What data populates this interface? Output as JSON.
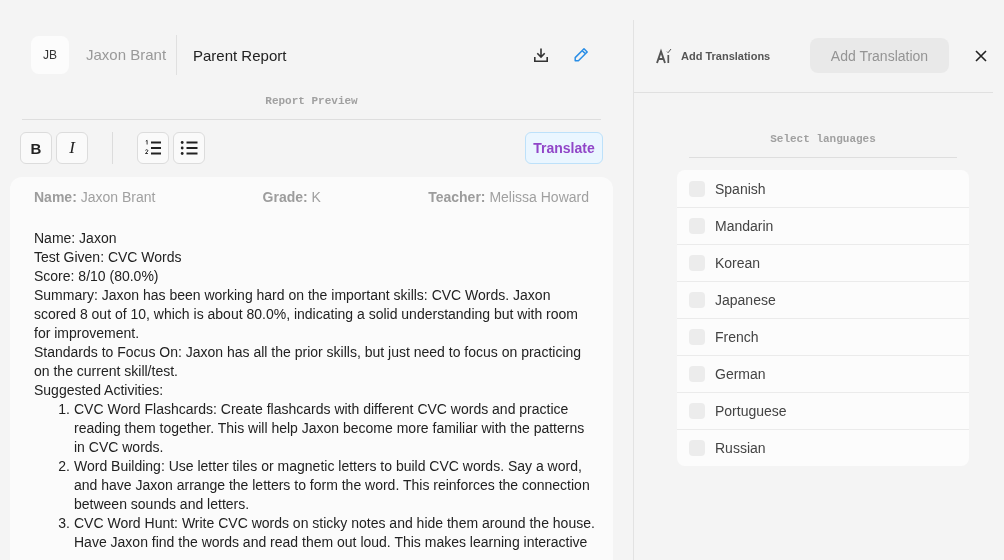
{
  "header": {
    "avatar": "JB",
    "student": "Jaxon Brant",
    "title": "Parent Report"
  },
  "preview_label": "Report Preview",
  "toolbar": {
    "groups": [
      {
        "items": [
          {
            "kind": "bold",
            "label": "B"
          },
          {
            "kind": "italic",
            "label": "I"
          }
        ]
      },
      {
        "items": [
          {
            "kind": "ordered-list"
          },
          {
            "kind": "bullet-list"
          }
        ]
      }
    ],
    "translate": "Translate"
  },
  "report": {
    "details": [
      {
        "label": "Name:",
        "value": "Jaxon Brant"
      },
      {
        "label": "Grade:",
        "value": "K"
      },
      {
        "label": "Teacher:",
        "value": "Melissa Howard"
      }
    ],
    "lines": [
      "Name: Jaxon",
      "Test Given: CVC Words",
      "Score: 8/10 (80.0%)",
      "Summary: Jaxon has been working hard on the important skills: CVC Words. Jaxon scored 8 out of 10, which is about 80.0%, indicating a solid understanding but with room for improvement.",
      "Standards to Focus On: Jaxon has all the prior skills, but just need to focus on practicing on the current skill/test.",
      "Suggested Activities:"
    ],
    "activities": [
      {
        "number": "1.",
        "text": "CVC Word Flashcards: Create flashcards with different CVC words and practice reading them together. This will help Jaxon become more familiar with the patterns in CVC words."
      },
      {
        "number": "2.",
        "text": "Word Building: Use letter tiles or magnetic letters to build CVC words. Say a word, and have Jaxon arrange the letters to form the word. This reinforces the connection between sounds and letters."
      },
      {
        "number": "3.",
        "text": "CVC Word Hunt: Write CVC words on sticky notes and hide them around the house. Have Jaxon find the words and read them out loud. This makes learning interactive"
      }
    ]
  },
  "translations": {
    "title": "Add Translations",
    "button": {
      "label": "Add Translation",
      "disabled": true
    },
    "prompt": "Select languages",
    "languages": [
      {
        "name": "Spanish",
        "checked": false
      },
      {
        "name": "Mandarin",
        "checked": false
      },
      {
        "name": "Korean",
        "checked": false
      },
      {
        "name": "Japanese",
        "checked": false
      },
      {
        "name": "French",
        "checked": false
      },
      {
        "name": "German",
        "checked": false
      },
      {
        "name": "Portuguese",
        "checked": false
      },
      {
        "name": "Russian",
        "checked": false
      }
    ]
  }
}
